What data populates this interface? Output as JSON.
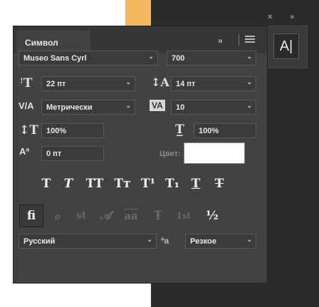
{
  "panel": {
    "tab_title": "Символ",
    "tab_chevrons": "»",
    "mini_close": "×",
    "mini_chevrons": "»",
    "mini_button": "A|"
  },
  "font": {
    "family": "Museo Sans Cyrl",
    "weight": "700"
  },
  "metrics": {
    "size": "22 пт",
    "leading": "14 пт",
    "kerning": "Метрически",
    "tracking": "10",
    "vertical_scale": "100%",
    "horizontal_scale": "100%",
    "baseline_shift": "0 пт",
    "color_label": "Цвет:"
  },
  "style_buttons": [
    "T",
    "T",
    "TT",
    "Tт",
    "T¹",
    "T₁",
    "T",
    "T"
  ],
  "opentype_buttons": [
    "fi",
    "ℴ",
    "st",
    "𝒜",
    "aa",
    "T",
    "1st",
    "½"
  ],
  "bottom": {
    "language": "Русский",
    "aa_label": "ªa",
    "antialias": "Резкое"
  },
  "colors": {
    "panel_bg": "#424242",
    "field_bg": "#3b3b3b",
    "text_color": "#ffffff"
  }
}
